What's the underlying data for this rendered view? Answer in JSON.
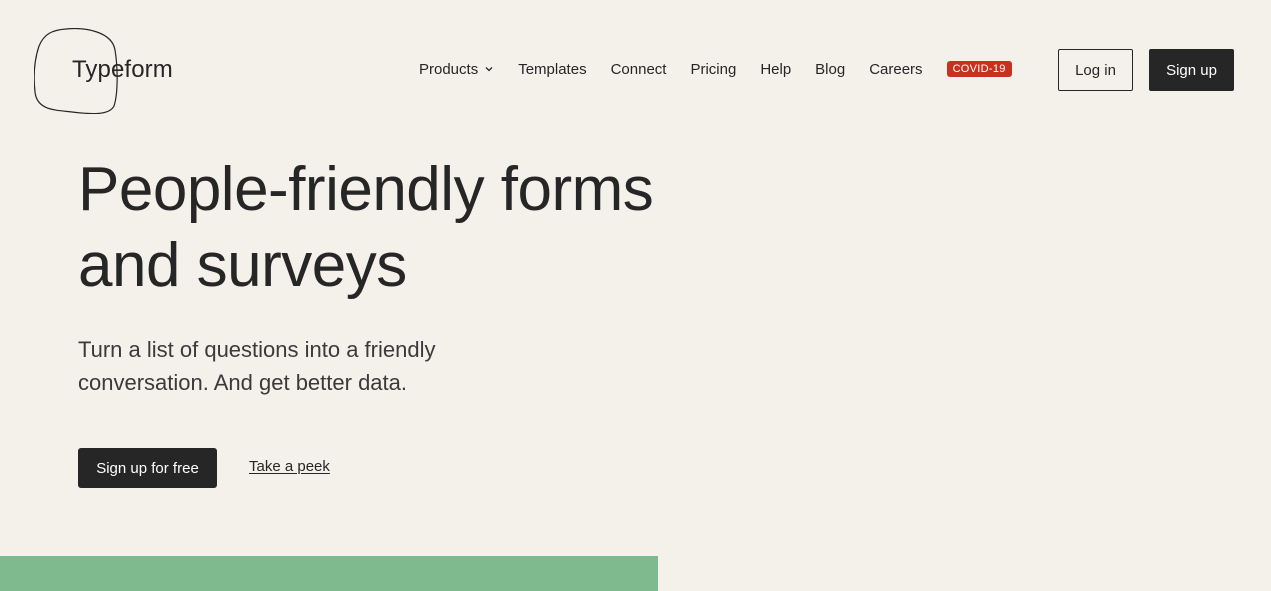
{
  "header": {
    "logo_text": "Typeform",
    "nav": {
      "products": "Products",
      "templates": "Templates",
      "connect": "Connect",
      "pricing": "Pricing",
      "help": "Help",
      "blog": "Blog",
      "careers": "Careers",
      "covid_badge": "COVID-19"
    },
    "login_label": "Log in",
    "signup_label": "Sign up"
  },
  "hero": {
    "title_line1": "People-friendly forms",
    "title_line2": "and surveys",
    "subtitle_line1": "Turn a list of questions into a friendly",
    "subtitle_line2": "conversation. And get better data.",
    "cta_primary": "Sign up for free",
    "cta_secondary": "Take a peek"
  },
  "icons": {
    "logo": "typeform-blob-logo",
    "products_dropdown": "chevron-down-icon"
  },
  "colors": {
    "background": "#f4f1eb",
    "text": "#262627",
    "covid_badge": "#c9311f",
    "green_band": "#7fba8f"
  }
}
